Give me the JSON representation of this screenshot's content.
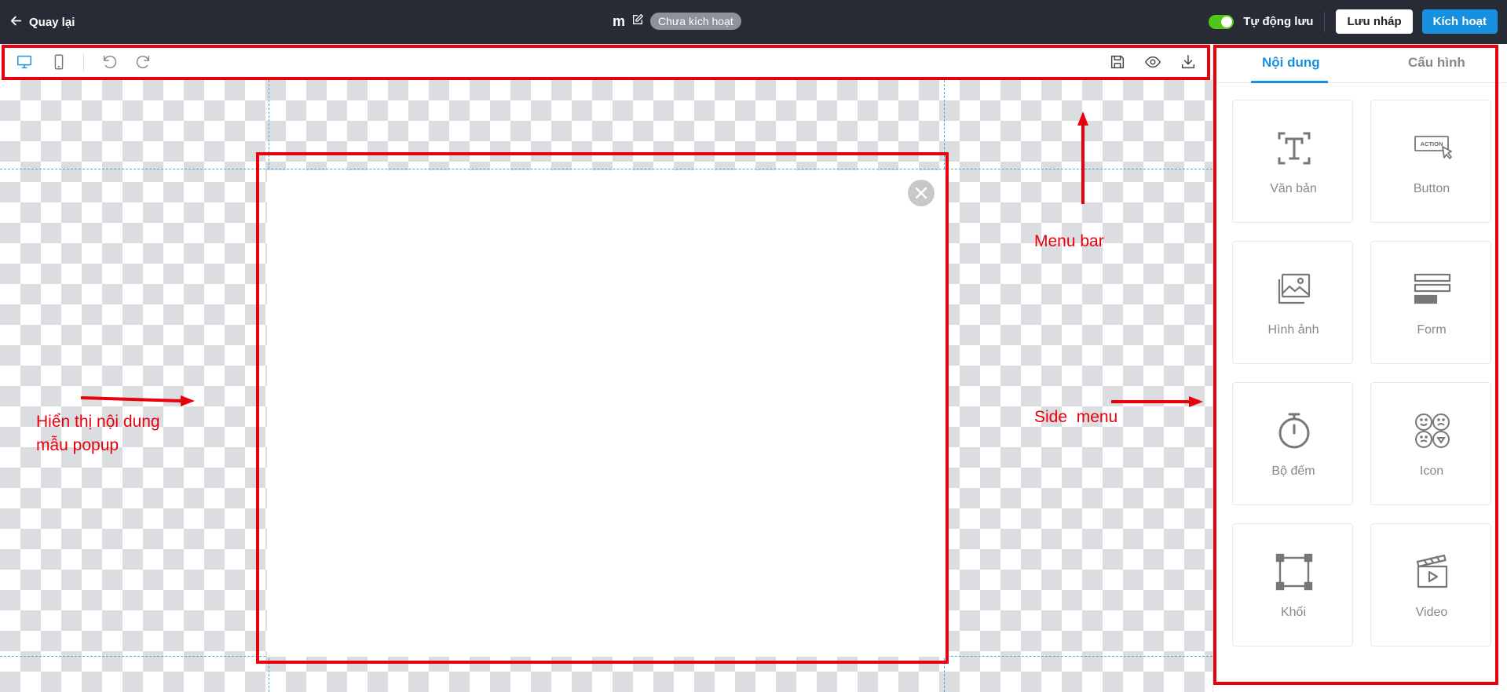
{
  "header": {
    "back_label": "Quay lại",
    "title": "m",
    "status_badge": "Chưa kích hoạt",
    "autosave_label": "Tự động lưu",
    "autosave_on": true,
    "draft_button": "Lưu nháp",
    "activate_button": "Kích hoạt"
  },
  "toolbar": {
    "left_icons": [
      "desktop-icon",
      "mobile-icon",
      "undo-icon",
      "redo-icon"
    ],
    "right_icons": [
      "save-icon",
      "preview-eye-icon",
      "download-icon"
    ]
  },
  "side_panel": {
    "tabs": [
      {
        "label": "Nội dung",
        "active": true
      },
      {
        "label": "Cấu hình",
        "active": false
      }
    ],
    "elements": [
      {
        "label": "Văn bản",
        "icon": "text-icon"
      },
      {
        "label": "Button",
        "icon": "action-button-icon",
        "icon_text": "ACTION"
      },
      {
        "label": "Hình ảnh",
        "icon": "image-icon"
      },
      {
        "label": "Form",
        "icon": "form-icon"
      },
      {
        "label": "Bộ đếm",
        "icon": "timer-icon"
      },
      {
        "label": "Icon",
        "icon": "emoji-icon"
      },
      {
        "label": "Khối",
        "icon": "block-icon"
      },
      {
        "label": "Video",
        "icon": "video-icon"
      }
    ]
  },
  "annotations": {
    "menu_bar": "Menu bar",
    "side_menu": "Side  menu",
    "popup_content_line1": "Hiển thị nội dung",
    "popup_content_line2": "mẫu popup"
  },
  "colors": {
    "header_bg": "#262b36",
    "accent": "#1890e0",
    "toggle_on": "#52c41a",
    "annotation_red": "#e8000b"
  }
}
